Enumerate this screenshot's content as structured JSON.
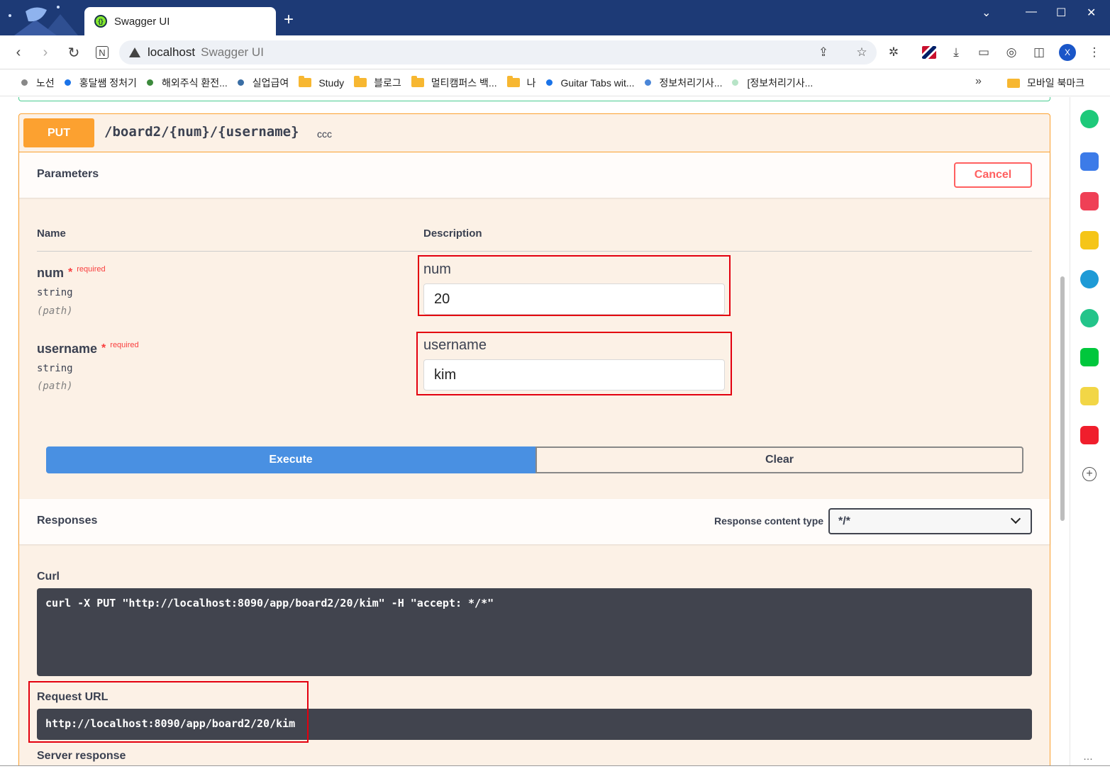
{
  "browser": {
    "tab_title": "Swagger UI",
    "new_tab_glyph": "+",
    "window_controls": [
      "⌄",
      "—",
      "☐",
      "✕"
    ],
    "address": {
      "host": "localhost",
      "title": "Swagger UI"
    },
    "avatar_letter": "X"
  },
  "bookmarks": {
    "items": [
      {
        "label": "노선",
        "type": "dot",
        "color": "#888888"
      },
      {
        "label": "홍달쌤 정처기",
        "type": "dot",
        "color": "#1a73e8"
      },
      {
        "label": "해외주식 환전...",
        "type": "dot",
        "color": "#3c8a3c"
      },
      {
        "label": "실업급여",
        "type": "dot",
        "color": "#3a6ea5"
      },
      {
        "label": "Study",
        "type": "folder"
      },
      {
        "label": "블로그",
        "type": "folder"
      },
      {
        "label": "멀티캠퍼스 백...",
        "type": "folder"
      },
      {
        "label": "나",
        "type": "folder"
      },
      {
        "label": "Guitar Tabs wit...",
        "type": "dot",
        "color": "#1a73e8"
      },
      {
        "label": "정보처리기사...",
        "type": "dot",
        "color": "#4a86d8"
      },
      {
        "label": "[정보처리기사...",
        "type": "dot",
        "color": "#b7e4c7"
      }
    ],
    "more_glyph": "»",
    "mobile_label": "모바일 북마크"
  },
  "operation": {
    "method": "PUT",
    "path": "/board2/{num}/{username}",
    "description": "ccc",
    "parameters_title": "Parameters",
    "cancel_label": "Cancel",
    "col_name": "Name",
    "col_description": "Description",
    "params": [
      {
        "name": "num",
        "star": "*",
        "required": "required",
        "type": "string",
        "in": "(path)",
        "label": "num",
        "value": "20"
      },
      {
        "name": "username",
        "star": "*",
        "required": "required",
        "type": "string",
        "in": "(path)",
        "label": "username",
        "value": "kim"
      }
    ],
    "execute_label": "Execute",
    "clear_label": "Clear",
    "responses_title": "Responses",
    "response_content_type_label": "Response content type",
    "response_content_type_value": "*/*",
    "curl_title": "Curl",
    "curl_command": "curl -X PUT \"http://localhost:8090/app/board2/20/kim\" -H \"accept: */*\"",
    "request_url_title": "Request URL",
    "request_url": "http://localhost:8090/app/board2/20/kim",
    "server_response_title": "Server response"
  },
  "colors": {
    "put": "#fca130",
    "execute": "#4990e2",
    "cancel": "#ff6060",
    "highlight": "#e3000f"
  }
}
